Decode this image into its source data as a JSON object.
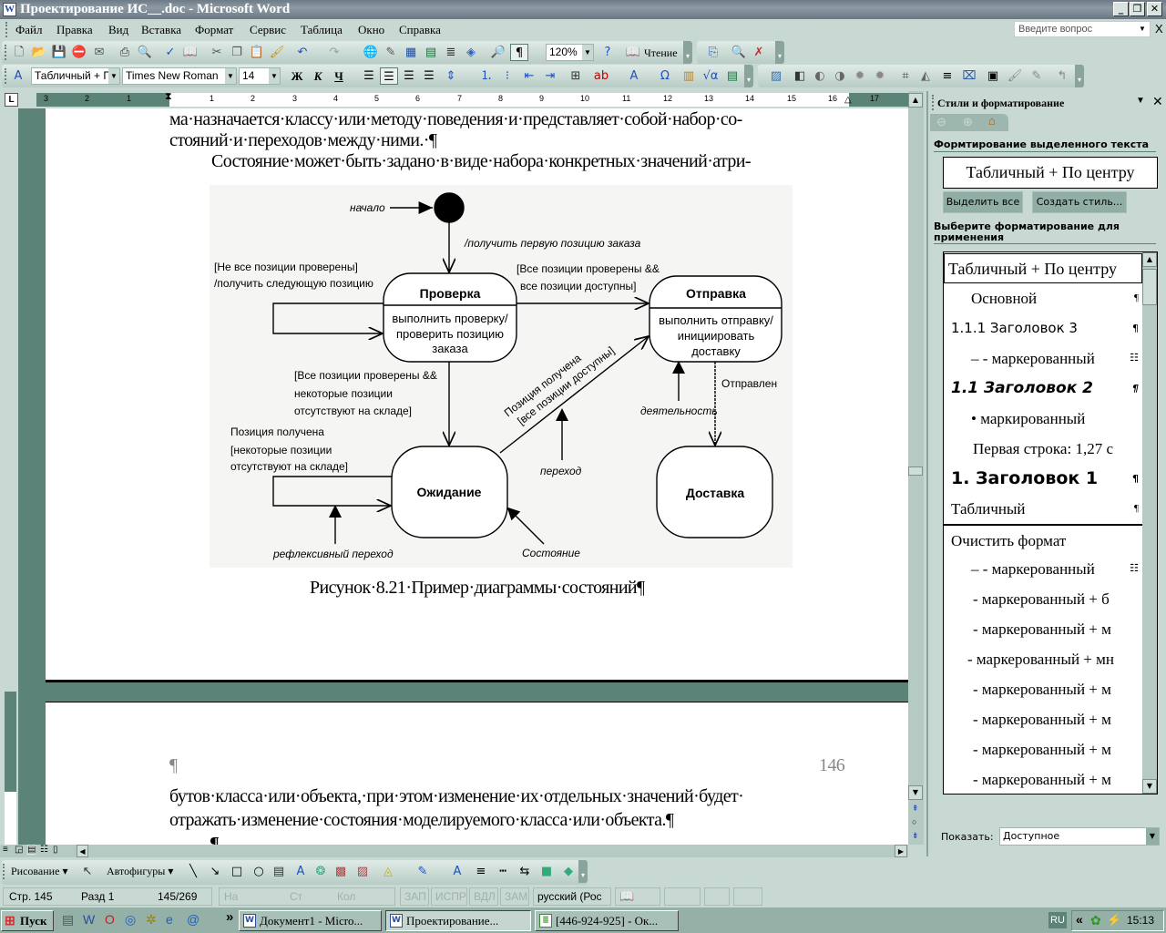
{
  "window": {
    "title": "Проектирование ИС__.doc - Microsoft Word",
    "minimize": "_",
    "restore": "❐",
    "close": "✕"
  },
  "menu": [
    "Файл",
    "Правка",
    "Вид",
    "Вставка",
    "Формат",
    "Сервис",
    "Таблица",
    "Окно",
    "Справка"
  ],
  "ask": {
    "placeholder": "Введите вопрос",
    "close": "X"
  },
  "standard_toolbar": {
    "zoom": "120%",
    "reading_label": "Чтение",
    "icons": [
      {
        "name": "new-document-icon",
        "glyph": "🗋",
        "color": "#333"
      },
      {
        "name": "open-icon",
        "glyph": "📂",
        "color": "#c9a020"
      },
      {
        "name": "save-icon",
        "glyph": "💾",
        "color": "#2a3f8f"
      },
      {
        "name": "permission-icon",
        "glyph": "⛔",
        "color": "#c03030"
      },
      {
        "name": "email-icon",
        "glyph": "✉",
        "color": "#555"
      },
      {
        "name": "print-icon",
        "glyph": "⎙",
        "color": "#333"
      },
      {
        "name": "print-preview-icon",
        "glyph": "🔍",
        "color": "#333"
      },
      {
        "name": "spelling-icon",
        "glyph": "✓",
        "color": "#2050c0"
      },
      {
        "name": "research-icon",
        "glyph": "📖",
        "color": "#7a5a20"
      },
      {
        "name": "cut-icon",
        "glyph": "✂",
        "color": "#555"
      },
      {
        "name": "copy-icon",
        "glyph": "❐",
        "color": "#555"
      },
      {
        "name": "paste-icon",
        "glyph": "📋",
        "color": "#a07020"
      },
      {
        "name": "format-painter-icon",
        "glyph": "🖌",
        "color": "#c09020"
      },
      {
        "name": "undo-icon",
        "glyph": "↶",
        "color": "#2050c0"
      },
      {
        "name": "redo-icon",
        "glyph": "↷",
        "color": "#8aa"
      },
      {
        "name": "hyperlink-icon",
        "glyph": "🌐",
        "color": "#2080a0"
      },
      {
        "name": "tables-borders-icon",
        "glyph": "✎",
        "color": "#555"
      },
      {
        "name": "insert-table-icon",
        "glyph": "▦",
        "color": "#2050a0"
      },
      {
        "name": "insert-excel-icon",
        "glyph": "▤",
        "color": "#207040"
      },
      {
        "name": "columns-icon",
        "glyph": "≣",
        "color": "#333"
      },
      {
        "name": "drawing-icon",
        "glyph": "◈",
        "color": "#3060c0"
      },
      {
        "name": "document-map-icon",
        "glyph": "🔎",
        "color": "#3060a0"
      },
      {
        "name": "show-hide-icon",
        "glyph": "¶",
        "color": "#000"
      },
      {
        "name": "help-icon",
        "glyph": "?",
        "color": "#2050c0"
      },
      {
        "name": "reading-layout-icon",
        "glyph": "📖",
        "color": "#555"
      },
      {
        "name": "shrink-to-fit-icon",
        "glyph": "⎘",
        "color": "#3060a0"
      },
      {
        "name": "compare-icon",
        "glyph": "🔍",
        "color": "#3060a0"
      },
      {
        "name": "reject-changes-icon",
        "glyph": "✗",
        "color": "#c03030"
      }
    ]
  },
  "formatting_toolbar": {
    "style": "Табличный + Пс",
    "font": "Times New Roman",
    "size": "14",
    "bold": "Ж",
    "italic": "К",
    "underline": "Ч",
    "icons": [
      {
        "name": "styles-formatting-icon",
        "glyph": "A",
        "color": "#2050c0"
      },
      {
        "name": "align-left-icon",
        "glyph": "☰",
        "color": "#000"
      },
      {
        "name": "align-center-icon",
        "glyph": "☰",
        "color": "#000"
      },
      {
        "name": "align-right-icon",
        "glyph": "☰",
        "color": "#000"
      },
      {
        "name": "justify-icon",
        "glyph": "☰",
        "color": "#000"
      },
      {
        "name": "line-spacing-icon",
        "glyph": "⇕",
        "color": "#2050c0"
      },
      {
        "name": "numbering-icon",
        "glyph": "⒈",
        "color": "#2050c0"
      },
      {
        "name": "bullets-icon",
        "glyph": "⁝",
        "color": "#2050c0"
      },
      {
        "name": "decrease-indent-icon",
        "glyph": "⇤",
        "color": "#2050c0"
      },
      {
        "name": "increase-indent-icon",
        "glyph": "⇥",
        "color": "#2050c0"
      },
      {
        "name": "borders-icon",
        "glyph": "⊞",
        "color": "#333"
      },
      {
        "name": "highlight-icon",
        "glyph": "ab",
        "color": "#c00000"
      },
      {
        "name": "font-color-icon",
        "glyph": "A",
        "color": "#2050c0"
      },
      {
        "name": "symbol-icon",
        "glyph": "Ω",
        "color": "#2050c0"
      },
      {
        "name": "chart-icon",
        "glyph": "▥",
        "color": "#c08020"
      },
      {
        "name": "equation-icon",
        "glyph": "√α",
        "color": "#2050c0"
      },
      {
        "name": "excel-icon",
        "glyph": "▤",
        "color": "#207040"
      },
      {
        "name": "insert-picture-icon",
        "glyph": "▨",
        "color": "#3070b0"
      },
      {
        "name": "color-icon",
        "glyph": "◧",
        "color": "#333"
      },
      {
        "name": "more-contrast-icon",
        "glyph": "◐",
        "color": "#666"
      },
      {
        "name": "less-contrast-icon",
        "glyph": "◑",
        "color": "#666"
      },
      {
        "name": "more-brightness-icon",
        "glyph": "✹",
        "color": "#888"
      },
      {
        "name": "less-brightness-icon",
        "glyph": "✹",
        "color": "#888"
      },
      {
        "name": "crop-icon",
        "glyph": "⌗",
        "color": "#444"
      },
      {
        "name": "rotate-icon",
        "glyph": "◭",
        "color": "#666"
      },
      {
        "name": "line-style-icon",
        "glyph": "≡",
        "color": "#000"
      },
      {
        "name": "compress-icon",
        "glyph": "⌧",
        "color": "#2050a0"
      },
      {
        "name": "text-wrapping-icon",
        "glyph": "▣",
        "color": "#000"
      },
      {
        "name": "format-picture-icon",
        "glyph": "🖌",
        "color": "#888"
      },
      {
        "name": "set-transparent-color-icon",
        "glyph": "✎",
        "color": "#888"
      },
      {
        "name": "reset-picture-icon",
        "glyph": "↰",
        "color": "#888"
      }
    ]
  },
  "ruler": {
    "numbers": [
      "3",
      "2",
      "1",
      "1",
      "2",
      "3",
      "4",
      "5",
      "6",
      "7",
      "8",
      "9",
      "10",
      "11",
      "12",
      "13",
      "14",
      "15",
      "16",
      "17"
    ],
    "tab_selector": "L"
  },
  "document": {
    "lines_top": [
      "ма·назначается·классу·или·методу·поведения·и·представляет·собой·набор·со-",
      "стояний·и·переходов·между·ними.·¶",
      "Состояние·может·быть·задано·в·виде·набора·конкретных·значений·атри-"
    ],
    "caption": "Рисунок·8.21·Пример·диаграммы·состояний¶",
    "header_mark": "¶",
    "page_number": "146",
    "lines_bottom": [
      "бутов·класса·или·объекта,·при·этом·изменение·их·отдельных·значений·будет·",
      "отражать·изменение·состояния·моделируемого·класса·или·объекта.¶"
    ],
    "trailing_mark": "¶"
  },
  "diagram": {
    "start_label": "начало",
    "first_transition": "/получить первую позицию заказа",
    "self_check": [
      "[Не все позиции проверены]",
      "/получить следующую позицию"
    ],
    "check_to_send": [
      "[Все позиции проверены &&",
      "все позиции доступны]"
    ],
    "check_to_wait": [
      "[Все позиции проверены &&",
      "некоторые позиции",
      "отсутствуют на складе]"
    ],
    "self_wait": [
      "Позиция получена",
      "[некоторые позиции",
      "отсутствуют на складе]"
    ],
    "wait_to_send": [
      "Позиция получена",
      "[все позиции доступны]"
    ],
    "sent_label": "Отправлен",
    "states": {
      "check": {
        "title": "Проверка",
        "body": [
          "выполнить проверку/",
          "проверить позицию",
          "заказа"
        ]
      },
      "send": {
        "title": "Отправка",
        "body": [
          "выполнить отправку/",
          "инициировать",
          "доставку"
        ]
      },
      "wait": {
        "title": "Ожидание"
      },
      "delivery": {
        "title": "Доставка"
      }
    },
    "annotations": {
      "activity": "деятельность",
      "transition": "переход",
      "reflexive": "рефлексивный переход",
      "state": "Состояние"
    }
  },
  "task_pane": {
    "title": "Стили и форматирование",
    "section_selected": "Формтирование выделенного текста",
    "current_style": "Табличный + По центру",
    "select_all": "Выделить все",
    "new_style": "Создать стиль...",
    "section_apply": "Выберите форматирование для применения",
    "styles": [
      {
        "label": "Табличный + По центру",
        "mark": ""
      },
      {
        "label": "Основной",
        "mark": "¶"
      },
      {
        "label": "1.1.1  Заголовок 3",
        "mark": "¶"
      },
      {
        "label": "–  - маркерованный",
        "mark": "☷"
      },
      {
        "label": "1.1  Заголовок 2",
        "mark": "¶"
      },
      {
        "label": "•  маркированный",
        "mark": ""
      },
      {
        "label": "Первая строка:  1,27 с",
        "mark": ""
      },
      {
        "label": "1.  Заголовок 1",
        "mark": "¶"
      },
      {
        "label": "Табличный",
        "mark": "¶"
      },
      {
        "label": "Очистить формат",
        "mark": ""
      },
      {
        "label": "–  - маркерованный",
        "mark": "☷"
      },
      {
        "label": "- маркерованный +  б",
        "mark": ""
      },
      {
        "label": "- маркерованный + м",
        "mark": ""
      },
      {
        "label": "- маркерованный + мн",
        "mark": ""
      },
      {
        "label": "- маркерованный + м",
        "mark": ""
      },
      {
        "label": "- маркерованный + м",
        "mark": ""
      },
      {
        "label": "- маркерованный + м",
        "mark": ""
      },
      {
        "label": "- маркерованный + м",
        "mark": ""
      }
    ],
    "show_label": "Показать:",
    "show_value": "Доступное"
  },
  "drawing_toolbar": {
    "draw": "Рисование",
    "autoshapes": "Автофигуры",
    "icons": [
      {
        "name": "select-objects-icon",
        "glyph": "↖",
        "color": "#333"
      },
      {
        "name": "line-icon",
        "glyph": "╲",
        "color": "#000"
      },
      {
        "name": "arrow-icon",
        "glyph": "↘",
        "color": "#000"
      },
      {
        "name": "rectangle-icon",
        "glyph": "□",
        "color": "#000"
      },
      {
        "name": "oval-icon",
        "glyph": "○",
        "color": "#000"
      },
      {
        "name": "text-box-icon",
        "glyph": "▤",
        "color": "#333"
      },
      {
        "name": "wordart-icon",
        "glyph": "A",
        "color": "#2050c0"
      },
      {
        "name": "diagram-icon",
        "glyph": "❂",
        "color": "#3a8"
      },
      {
        "name": "clip-art-icon",
        "glyph": "▩",
        "color": "#a44"
      },
      {
        "name": "picture-icon",
        "glyph": "▨",
        "color": "#a44"
      },
      {
        "name": "fill-color-icon",
        "glyph": "◬",
        "color": "#c9b000"
      },
      {
        "name": "line-color-icon",
        "glyph": "✎",
        "color": "#2050c0"
      },
      {
        "name": "font-color-icon",
        "glyph": "A",
        "color": "#2050c0"
      },
      {
        "name": "line-style-icon",
        "glyph": "≡",
        "color": "#000"
      },
      {
        "name": "dash-style-icon",
        "glyph": "┅",
        "color": "#000"
      },
      {
        "name": "arrow-style-icon",
        "glyph": "⇆",
        "color": "#000"
      },
      {
        "name": "shadow-icon",
        "glyph": "■",
        "color": "#3a7"
      },
      {
        "name": "3d-icon",
        "glyph": "◆",
        "color": "#3a7"
      }
    ]
  },
  "status": {
    "page": "Стр. 145",
    "section": "Разд 1",
    "pages": "145/269",
    "at": "На",
    "line": "Ст",
    "col": "Кол",
    "rec": "ЗАП",
    "trk": "ИСПР",
    "ext": "ВДЛ",
    "ovr": "ЗАМ",
    "language": "русский (Рос"
  },
  "taskbar": {
    "start": "Пуск",
    "more": "»",
    "tasks": [
      "Документ1 - Micro...",
      "Проектирование...",
      "[446-924-925] - Ок..."
    ],
    "lang": "RU",
    "tray_expand": "«",
    "clock": "15:13"
  },
  "colors": {
    "chrome": "#c8d9d3",
    "workspace": "#5b8378",
    "pane_button": "#90aea5"
  }
}
